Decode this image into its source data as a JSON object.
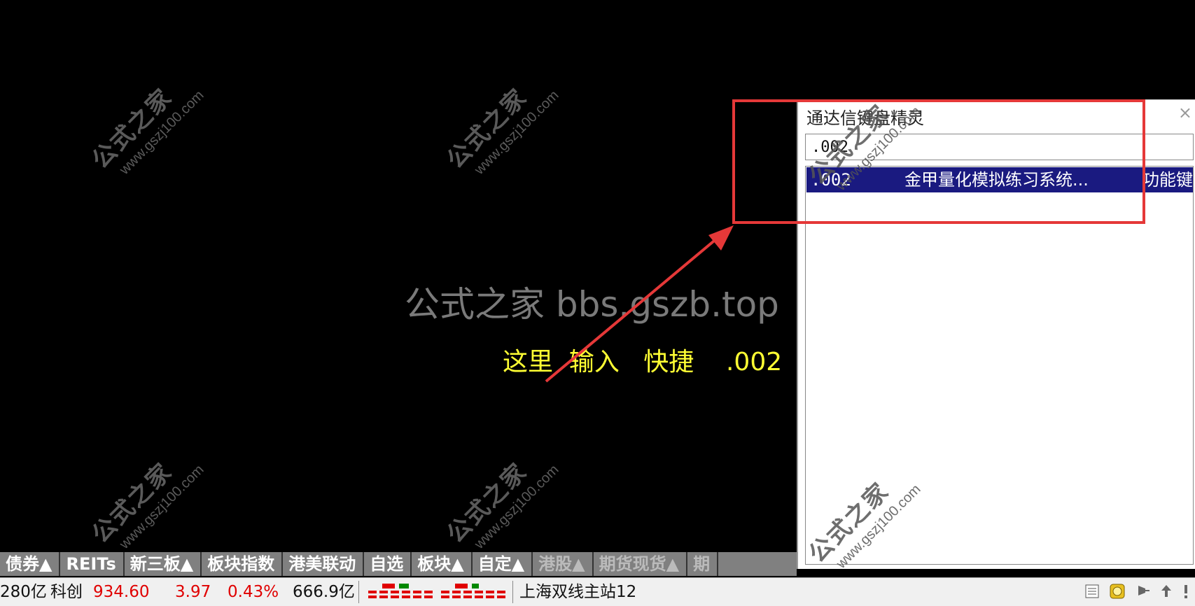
{
  "watermarks": {
    "site_cn": "公式之家",
    "site_url": "www.gszj100.com",
    "center_text": "公式之家 bbs.gszb.top"
  },
  "hint_text": "这里  输入   快捷    .002",
  "colors": {
    "background": "#000000",
    "hint": "#ffff33",
    "highlight_box": "#e53838",
    "selected_row": "#1a1a80",
    "price_up": "#e00000"
  },
  "keyboard_wizard": {
    "title": "通达信键盘精灵",
    "close_icon": "×",
    "input_value": ".002",
    "results": [
      {
        "code": ".002",
        "name": "金甲量化模拟练习系统...",
        "type": "功能键"
      }
    ]
  },
  "tabs": [
    {
      "label": "债券▲",
      "dim": false
    },
    {
      "label": "REITs",
      "dim": false
    },
    {
      "label": "新三板▲",
      "dim": false
    },
    {
      "label": "板块指数",
      "dim": false
    },
    {
      "label": "港美联动",
      "dim": false
    },
    {
      "label": "自选",
      "dim": false
    },
    {
      "label": "板块▲",
      "dim": false
    },
    {
      "label": "自定▲",
      "dim": false
    },
    {
      "label": "港股▲",
      "dim": true
    },
    {
      "label": "期货现货▲",
      "dim": true
    },
    {
      "label": "期",
      "dim": true
    }
  ],
  "status_bar": {
    "prev_amount": "280亿",
    "index_name": "科创",
    "index_value": "934.60",
    "index_change": "3.97",
    "index_pct": "0.43%",
    "index_amount": "666.9亿",
    "server": "上海双线主站12",
    "icons": [
      "list-icon",
      "coin-icon",
      "broadcast-icon",
      "upload-icon",
      "alert-icon"
    ]
  }
}
